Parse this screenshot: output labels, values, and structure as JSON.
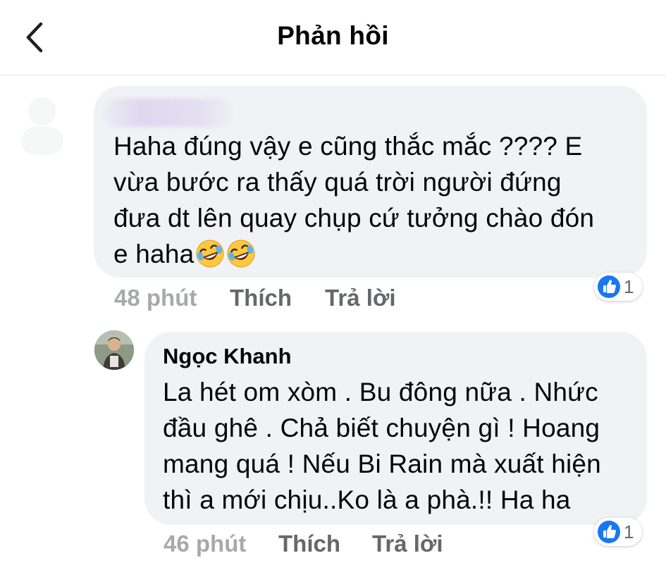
{
  "header": {
    "title": "Phản hồi",
    "back_icon": "chevron-left-icon"
  },
  "comments": [
    {
      "author": "",
      "text": "Haha đúng vậy e cũng thắc mắc ???? E\nvừa bước ra thấy quá trời người đứng\nđưa dt lên quay chụp cứ tưởng chào đón\ne haha",
      "emojis": [
        "rolling-on-floor-laughing-emoji",
        "rolling-on-floor-laughing-emoji"
      ],
      "time": "48 phút",
      "like_label": "Thích",
      "reply_label": "Trả lời",
      "reaction": {
        "type": "like",
        "count": "1"
      }
    },
    {
      "author": "Ngọc Khanh",
      "text": "La hét om xòm . Bu đông nữa . Nhức\nđầu ghê . Chả biết chuyện gì ! Hoang\nmang quá ! Nếu Bi Rain mà xuất hiện\nthì a mới chịu..Ko là a phà.!! Ha ha",
      "time": "46 phút",
      "like_label": "Thích",
      "reply_label": "Trả lời",
      "reaction": {
        "type": "like",
        "count": "1"
      }
    }
  ],
  "colors": {
    "bubble": "#f0f2f5",
    "meta": "#65676b",
    "like_blue": "#1877f2",
    "emoji_yellow": "#ffc83d"
  }
}
